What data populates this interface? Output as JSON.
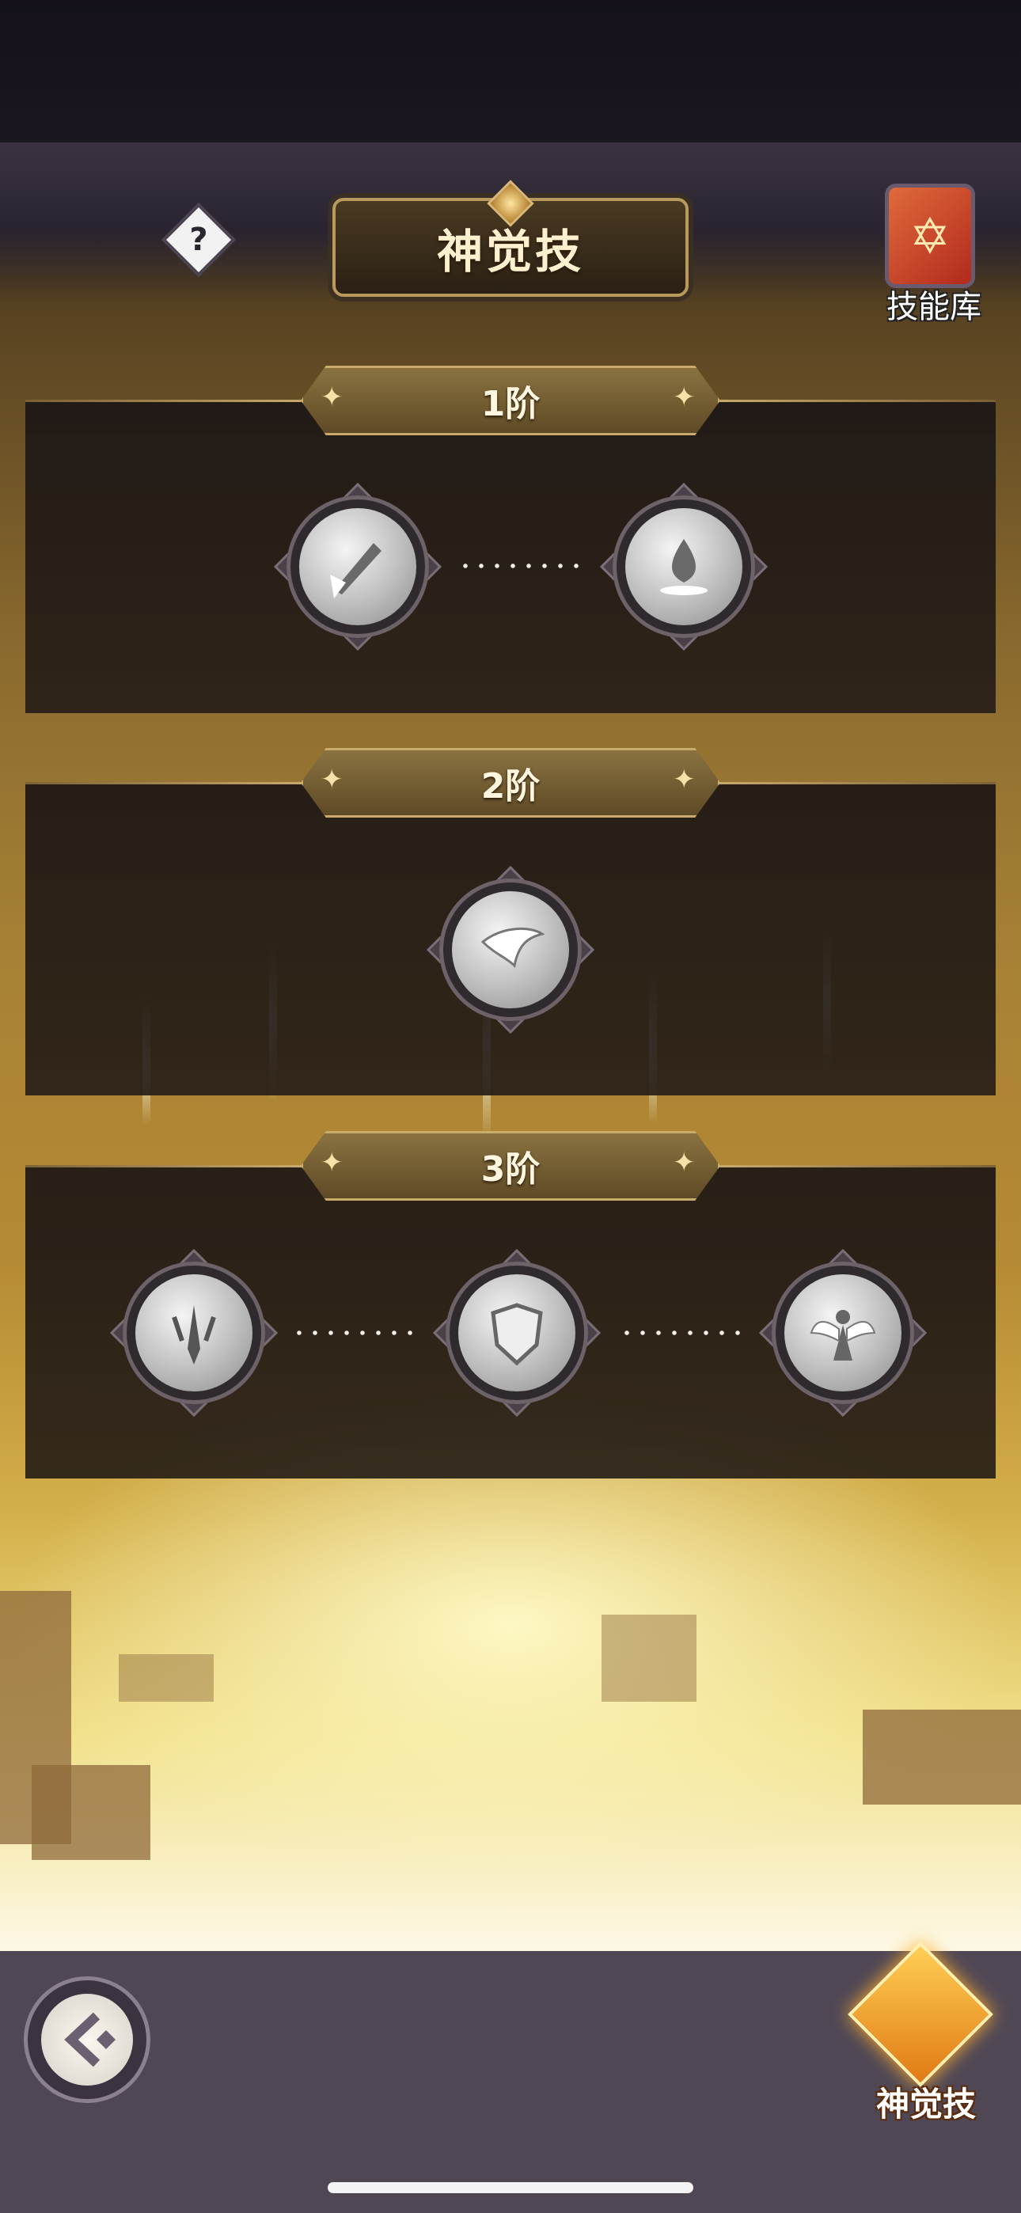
{
  "header": {
    "title": "神觉技",
    "help_glyph": "?",
    "skill_library_label": "技能库"
  },
  "tiers": [
    {
      "label": "1阶",
      "skills": [
        "sword-shatter-skill-icon",
        "water-drop-skill-icon"
      ]
    },
    {
      "label": "2阶",
      "skills": [
        "wing-skill-icon"
      ]
    },
    {
      "label": "3阶",
      "skills": [
        "trident-sword-skill-icon",
        "shield-skill-icon",
        "winged-goddess-skill-icon"
      ]
    }
  ],
  "bottom_bar": {
    "back_icon": "back-arrow-icon",
    "active_tab_label": "神觉技"
  },
  "colors": {
    "accent_gold": "#c9ab6c",
    "panel_dark": "#1c1614",
    "bottom_bar": "#504755"
  }
}
